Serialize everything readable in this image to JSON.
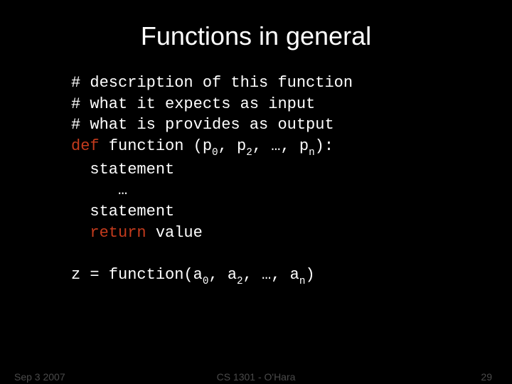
{
  "title": "Functions in general",
  "code": {
    "c1": "# description of this function",
    "c2": "# what it expects as input",
    "c3": "# what is provides as output",
    "kw_def": "def",
    "fn_name": " function (p",
    "sep": ", ",
    "p": "p",
    "a": "a",
    "ellipsis": "…",
    "close_def": "):",
    "close_call": ")",
    "sub0": "0",
    "sub2": "2",
    "subn": "n",
    "stmt": "  statement",
    "body_ellipsis": "     …",
    "kw_return": "return",
    "return_prefix": "  ",
    "return_val": " value",
    "call_prefix": "z = function(a"
  },
  "footer": {
    "left": "Sep 3 2007",
    "center": "CS 1301 - O'Hara",
    "right": "29"
  }
}
